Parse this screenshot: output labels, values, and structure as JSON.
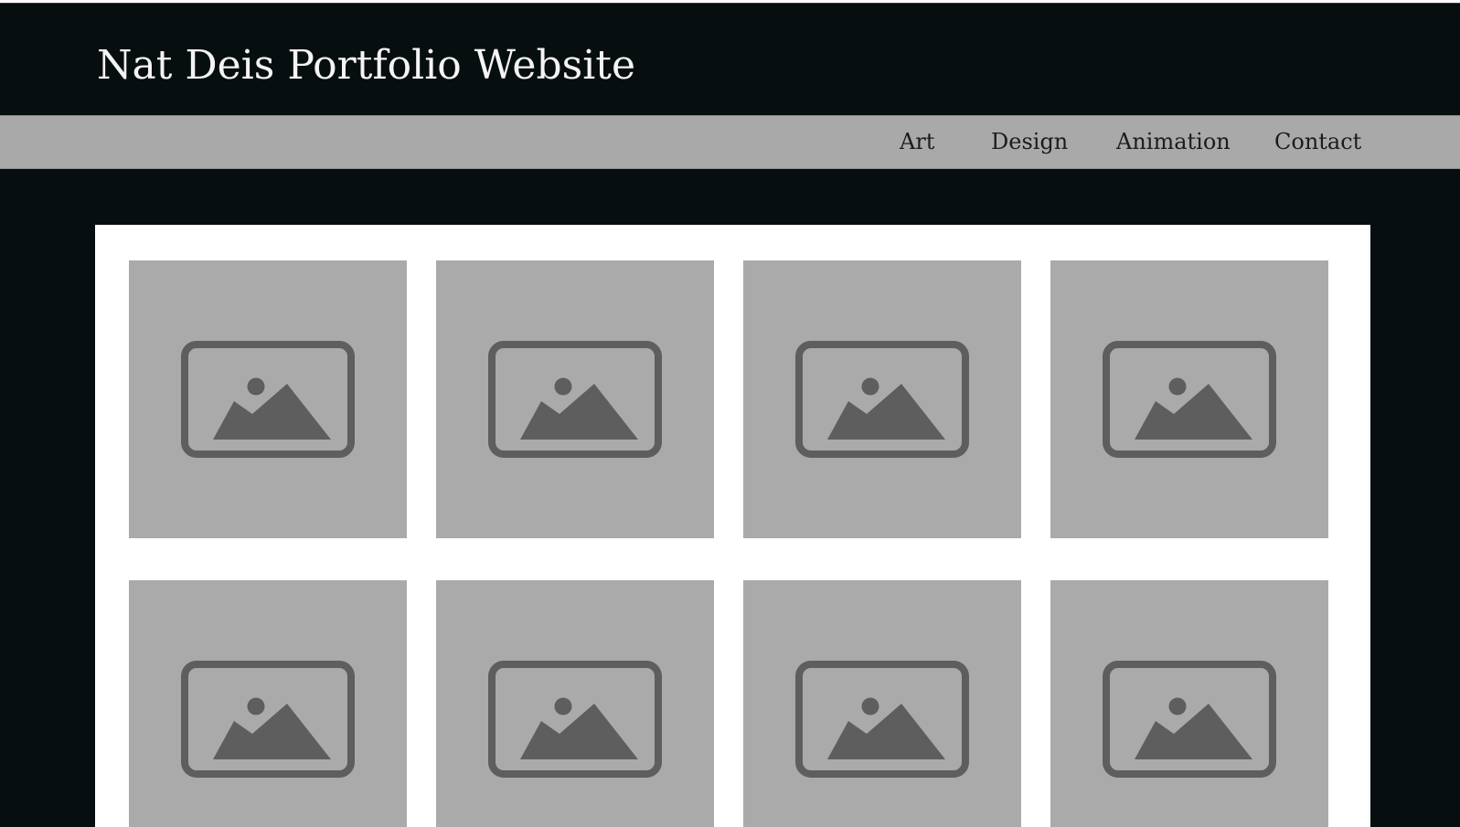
{
  "header": {
    "title": "Nat Deis Portfolio Website"
  },
  "nav": {
    "items": [
      {
        "label": "Art"
      },
      {
        "label": "Design"
      },
      {
        "label": "Animation"
      },
      {
        "label": "Contact"
      }
    ]
  },
  "gallery": {
    "tile_icon": "image-placeholder-icon",
    "tile_count": 8
  },
  "colors": {
    "background": "#070e0f",
    "nav_bar": "#a9a9a9",
    "gallery_panel": "#ffffff",
    "tile": "#aaaaaa",
    "icon": "#5e5e5e",
    "title_text": "#f4f4f4",
    "nav_text": "#1c1c1c"
  }
}
